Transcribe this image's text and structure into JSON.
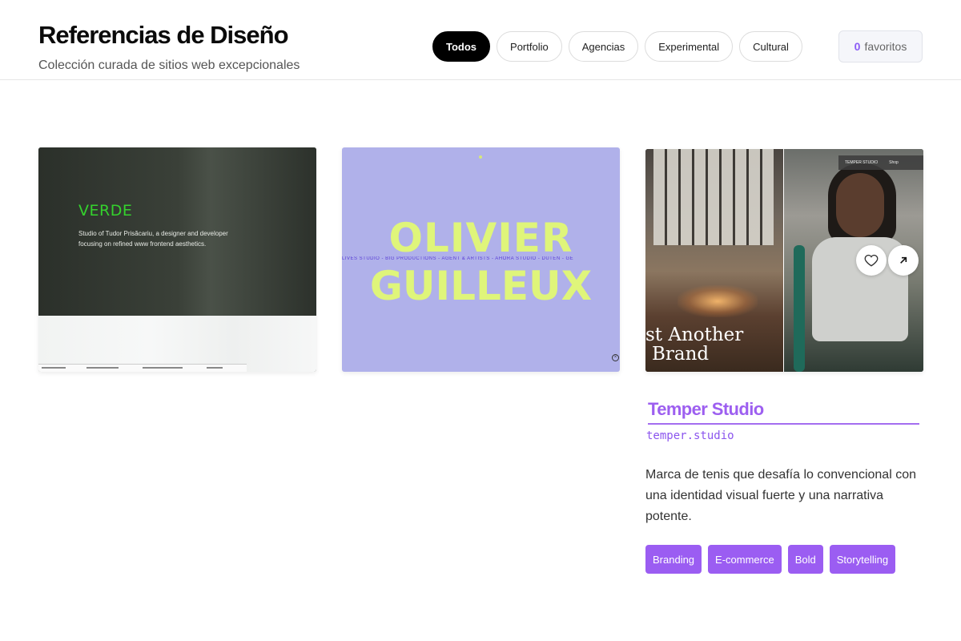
{
  "header": {
    "title": "Referencias de Diseño",
    "subtitle": "Colección curada de sitios web excepcionales"
  },
  "filters": [
    {
      "label": "Todos",
      "active": true
    },
    {
      "label": "Portfolio",
      "active": false
    },
    {
      "label": "Agencias",
      "active": false
    },
    {
      "label": "Experimental",
      "active": false
    },
    {
      "label": "Cultural",
      "active": false
    }
  ],
  "favorites": {
    "count": "0",
    "label": "favoritos"
  },
  "cards": [
    {
      "preview_brand": "VERDE",
      "preview_text": "Studio of Tudor Prisăcariu, a designer and developer focusing on refined www frontend aesthetics."
    },
    {
      "preview_line1": "OLIVIER",
      "preview_line2": "GUILLEUX",
      "preview_ticker": "LIVES STUDIO - BIG PRODUCTIONS - AGENT & ARTISTS - AHORA STUDIO - DUTEN - GE"
    },
    {
      "preview_nav": [
        "TEMPER STUDIO",
        "Shop"
      ],
      "preview_overlay_1": "st Another",
      "preview_overlay_2": "Brand"
    }
  ],
  "detail": {
    "name": "Temper Studio",
    "url": "temper.studio",
    "description": "Marca de tenis que desafía lo convencional con una identidad visual fuerte y una narrativa potente.",
    "tags": [
      "Branding",
      "E-commerce",
      "Bold",
      "Storytelling"
    ]
  },
  "colors": {
    "accent": "#9b5df2",
    "active_pill": "#000000",
    "verde": "#34d12d",
    "olivier_bg": "#b0b1ea",
    "olivier_text": "#dff57a"
  }
}
